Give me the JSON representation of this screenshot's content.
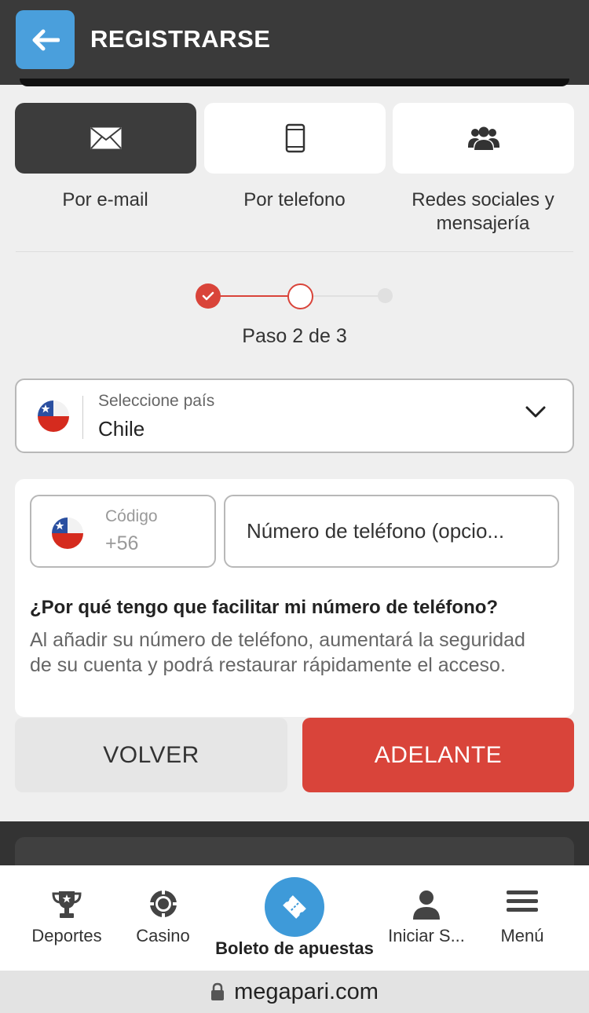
{
  "header": {
    "title": "REGISTRARSE"
  },
  "tabs": [
    {
      "label": "Por e-mail",
      "icon": "envelope-icon",
      "active": true
    },
    {
      "label": "Por telefono",
      "icon": "phone-icon",
      "active": false
    },
    {
      "label": "Redes sociales y mensajería",
      "icon": "users-icon",
      "active": false
    }
  ],
  "stepper": {
    "text": "Paso 2 de 3",
    "current_step": 2,
    "total_steps": 3
  },
  "country": {
    "label": "Seleccione país",
    "value": "Chile"
  },
  "phone": {
    "code_label": "Código",
    "code_value": "+56",
    "number_placeholder": "Número de teléfono (opcio..."
  },
  "info": {
    "title": "¿Por qué tengo que facilitar mi número de teléfono?",
    "text": "Al añadir su número de teléfono, aumentará la seguridad de su cuenta y podrá restaurar rápidamente el acceso."
  },
  "buttons": {
    "back": "VOLVER",
    "next": "ADELANTE"
  },
  "bottom_nav": {
    "sports": "Deportes",
    "casino": "Casino",
    "bet_slip": "Boleto de apuestas",
    "login": "Iniciar S...",
    "menu": "Menú"
  },
  "url": {
    "domain": "megapari.com"
  },
  "colors": {
    "accent_red": "#d9443a",
    "accent_blue": "#4a9fdc",
    "dark": "#3a3a3a"
  }
}
